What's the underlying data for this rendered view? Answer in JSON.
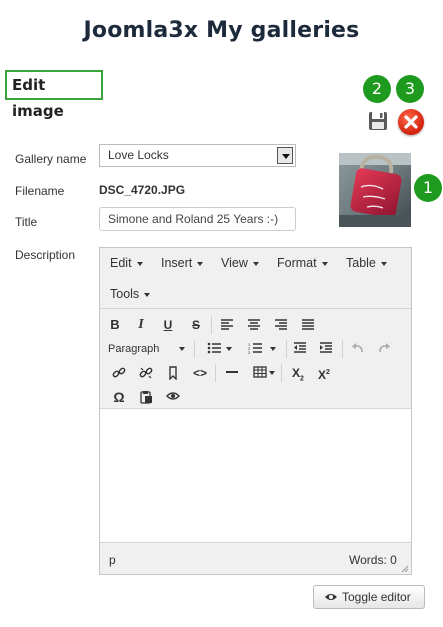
{
  "page_title": "Joomla3x My galleries",
  "section_title": "Edit image",
  "badges": [
    "1",
    "2",
    "3"
  ],
  "form": {
    "gallery_label": "Gallery name",
    "gallery_value": "Love Locks",
    "filename_label": "Filename",
    "filename_value": "DSC_4720.JPG",
    "title_label": "Title",
    "title_value": "Simone and Roland 25 Years :-)",
    "description_label": "Description"
  },
  "editor": {
    "menus": [
      "Edit",
      "Insert",
      "View",
      "Format",
      "Table",
      "Tools"
    ],
    "format_select": "Paragraph",
    "status_path": "p",
    "word_count": "Words: 0"
  },
  "toggle_editor_label": "Toggle editor",
  "colors": {
    "badge": "#1e9a1e",
    "edit_box_border": "#3aa33a",
    "cancel_red": "#d2200a",
    "title_text": "#1c2a3b"
  },
  "icons": [
    "save-icon",
    "cancel-icon",
    "eye-icon",
    "bold-icon",
    "italic-icon",
    "underline-icon",
    "strikethrough-icon",
    "align-left-icon",
    "align-center-icon",
    "align-right-icon",
    "align-justify-icon",
    "bullet-list-icon",
    "numbered-list-icon",
    "outdent-icon",
    "indent-icon",
    "undo-icon",
    "redo-icon",
    "link-icon",
    "unlink-icon",
    "bookmark-icon",
    "code-icon",
    "horizontal-rule-icon",
    "table-icon",
    "subscript-icon",
    "superscript-icon",
    "special-char-icon",
    "paste-icon",
    "preview-icon"
  ]
}
